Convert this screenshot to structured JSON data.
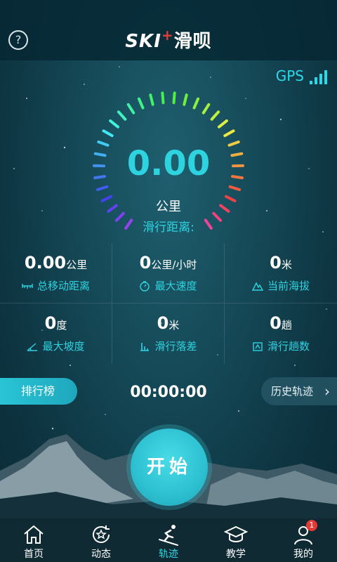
{
  "header": {
    "logo_ski": "SKI",
    "logo_plus": "+",
    "logo_cn": "滑呗",
    "help_label": "?"
  },
  "gps": {
    "label": "GPS",
    "signal_bars": 4
  },
  "main": {
    "distance_value": "0.00",
    "distance_unit": "公里",
    "distance_label": "滑行距离:"
  },
  "stats": [
    {
      "value": "0.00",
      "unit": "公里",
      "label": "总移动距离",
      "icon": "ruler-icon"
    },
    {
      "value": "0",
      "unit": "公里/小时",
      "label": "最大速度",
      "icon": "stopwatch-icon"
    },
    {
      "value": "0",
      "unit": "米",
      "label": "当前海拔",
      "icon": "mountain-icon"
    },
    {
      "value": "0",
      "unit": "度",
      "label": "最大坡度",
      "icon": "slope-icon"
    },
    {
      "value": "0",
      "unit": "米",
      "label": "滑行落差",
      "icon": "drop-icon"
    },
    {
      "value": "0",
      "unit": "趟",
      "label": "滑行趟数",
      "icon": "runs-icon"
    }
  ],
  "controls": {
    "rank_label": "排行榜",
    "timer": "00:00:00",
    "history_label": "历史轨迹",
    "start_label": "开始"
  },
  "tabs": [
    {
      "label": "首页",
      "icon": "home-icon",
      "active": false
    },
    {
      "label": "动态",
      "icon": "star-refresh-icon",
      "active": false
    },
    {
      "label": "轨迹",
      "icon": "skier-icon",
      "active": true
    },
    {
      "label": "教学",
      "icon": "graduation-cap-icon",
      "active": false
    },
    {
      "label": "我的",
      "icon": "user-icon",
      "active": false,
      "badge": "1"
    }
  ],
  "colors": {
    "accent": "#2ed3e0",
    "badge": "#e53935",
    "background": "#164b59"
  }
}
